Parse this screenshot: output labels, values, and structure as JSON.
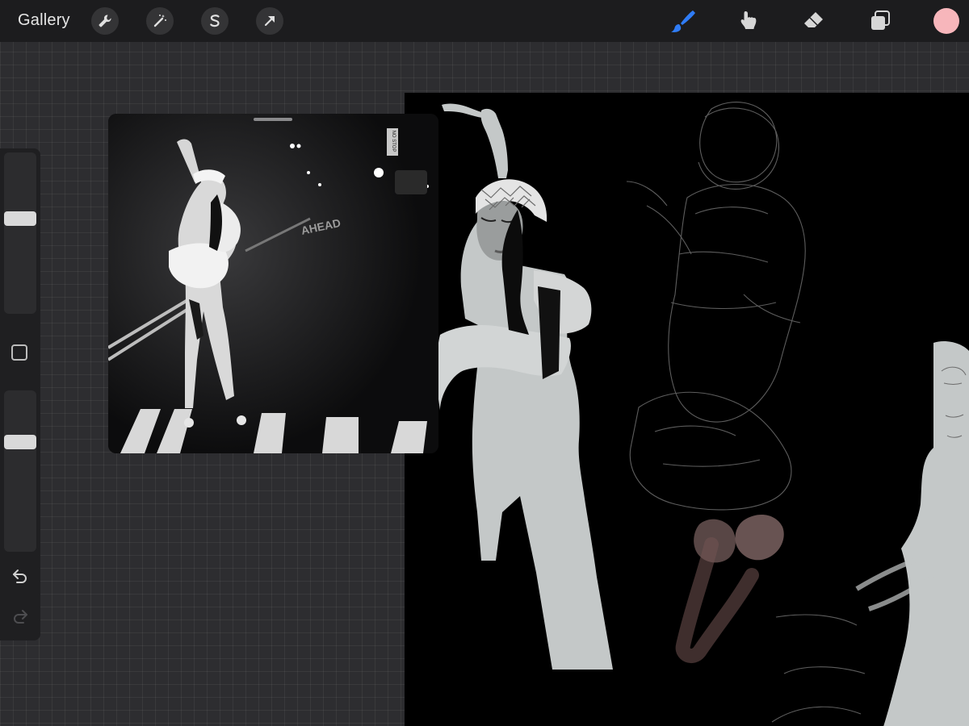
{
  "topbar": {
    "gallery_label": "Gallery",
    "left_tools": [
      {
        "name": "actions-wrench-icon"
      },
      {
        "name": "adjustments-wand-icon"
      },
      {
        "name": "selection-s-icon"
      },
      {
        "name": "transform-arrow-icon"
      }
    ],
    "right_tools": [
      {
        "name": "brush-icon",
        "active": true,
        "color": "#2f7cf6"
      },
      {
        "name": "smudge-icon"
      },
      {
        "name": "eraser-icon"
      },
      {
        "name": "layers-icon"
      }
    ],
    "current_color": "#f7b6bb"
  },
  "reference": {
    "street_text": "AHEAD",
    "sign_text": "NO STOP"
  },
  "sidebar": {
    "brush_size_level": 0.6,
    "opacity_level": 0.7
  },
  "colors": {
    "accent": "#2f7cf6",
    "canvas_background": "#000000",
    "figure_fill": "#c4c8c8",
    "sketch_pink": "#c9a09e"
  }
}
